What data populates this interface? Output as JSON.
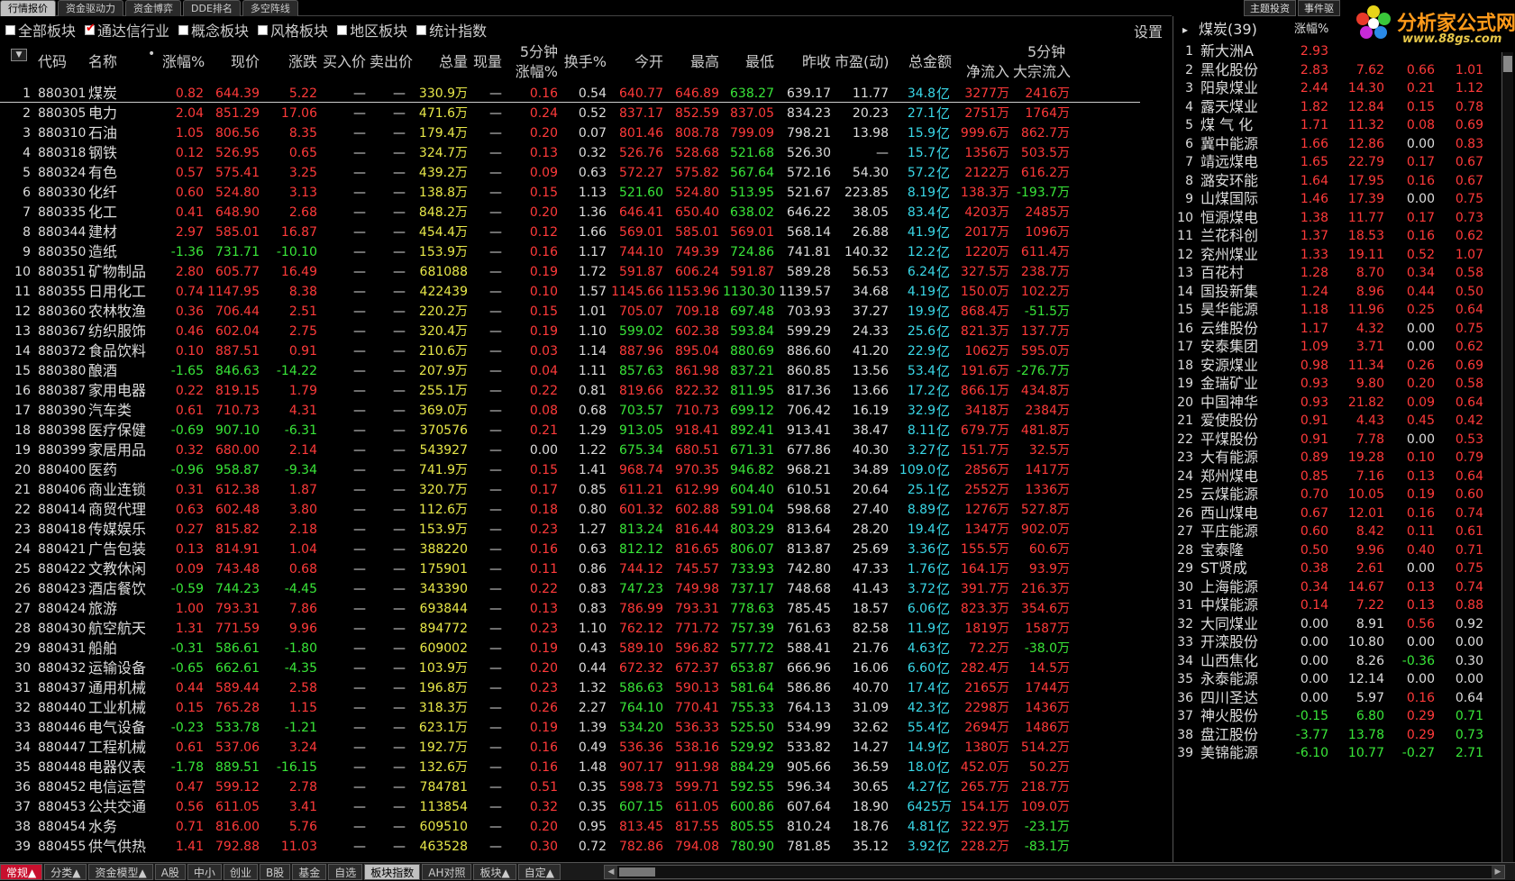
{
  "top_tabs": [
    {
      "label": "行情报价",
      "active": true
    },
    {
      "label": "资金驱动力",
      "active": false
    },
    {
      "label": "资金博弈",
      "active": false
    },
    {
      "label": "DDE排名",
      "active": false
    },
    {
      "label": "多空阵线",
      "active": false
    }
  ],
  "top_right_tabs": [
    "主题投资",
    "事件驱"
  ],
  "logo": {
    "title": "分析家公式网",
    "url": "www.88gs.com"
  },
  "filters": [
    {
      "label": "全部板块",
      "checked": false
    },
    {
      "label": "通达信行业",
      "checked": true
    },
    {
      "label": "概念板块",
      "checked": false
    },
    {
      "label": "风格板块",
      "checked": false
    },
    {
      "label": "地区板块",
      "checked": false
    },
    {
      "label": "统计指数",
      "checked": false
    }
  ],
  "settings_label": "设置",
  "headers": {
    "code": "代码",
    "name": "名称",
    "pct": "涨幅%",
    "price": "现价",
    "chg": "涨跌",
    "bid": "买入价",
    "ask": "卖出价",
    "vol": "总量",
    "cur": "现量",
    "m5_a": "5分钟",
    "m5_b": "涨幅%",
    "turn": "换手%",
    "open": "今开",
    "high": "最高",
    "low": "最低",
    "prev": "昨收",
    "pe": "市盈(动)",
    "amt": "总金额",
    "flow_top": "5分钟",
    "net": "净流入",
    "block": "大宗流入"
  },
  "rows": [
    [
      "1",
      "880301",
      "煤炭",
      "0.82",
      "644.39",
      "5.22",
      "—",
      "—",
      "330.9万",
      "—",
      "0.16",
      "0.54",
      "640.77",
      "646.89",
      "638.27",
      "639.17",
      "11.77",
      "34.8",
      "3277万",
      "2416万"
    ],
    [
      "2",
      "880305",
      "电力",
      "2.04",
      "851.29",
      "17.06",
      "—",
      "—",
      "471.6万",
      "—",
      "0.24",
      "0.52",
      "837.17",
      "852.59",
      "837.05",
      "834.23",
      "20.23",
      "27.1",
      "2751万",
      "1764万"
    ],
    [
      "3",
      "880310",
      "石油",
      "1.05",
      "806.56",
      "8.35",
      "—",
      "—",
      "179.4万",
      "—",
      "0.20",
      "0.07",
      "801.46",
      "808.78",
      "799.09",
      "798.21",
      "13.98",
      "15.9",
      "999.6万",
      "862.7万"
    ],
    [
      "4",
      "880318",
      "钢铁",
      "0.12",
      "526.95",
      "0.65",
      "—",
      "—",
      "324.7万",
      "—",
      "0.13",
      "0.32",
      "526.76",
      "528.68",
      "521.68",
      "526.30",
      "—",
      "15.7",
      "1356万",
      "503.5万"
    ],
    [
      "5",
      "880324",
      "有色",
      "0.57",
      "575.41",
      "3.25",
      "—",
      "—",
      "439.2万",
      "—",
      "0.09",
      "0.63",
      "572.27",
      "575.82",
      "567.64",
      "572.16",
      "54.30",
      "57.2",
      "2122万",
      "616.2万"
    ],
    [
      "6",
      "880330",
      "化纤",
      "0.60",
      "524.80",
      "3.13",
      "—",
      "—",
      "138.8万",
      "—",
      "0.15",
      "1.13",
      "521.60",
      "524.80",
      "513.95",
      "521.67",
      "223.85",
      "8.19",
      "138.3万",
      "-193.7万"
    ],
    [
      "7",
      "880335",
      "化工",
      "0.41",
      "648.90",
      "2.68",
      "—",
      "—",
      "848.2万",
      "—",
      "0.20",
      "1.36",
      "646.41",
      "650.40",
      "638.02",
      "646.22",
      "38.05",
      "83.4",
      "4203万",
      "2485万"
    ],
    [
      "8",
      "880344",
      "建材",
      "2.97",
      "585.01",
      "16.87",
      "—",
      "—",
      "454.4万",
      "—",
      "0.12",
      "1.66",
      "569.01",
      "585.01",
      "569.01",
      "568.14",
      "26.88",
      "41.9",
      "2017万",
      "1096万"
    ],
    [
      "9",
      "880350",
      "造纸",
      "-1.36",
      "731.71",
      "-10.10",
      "—",
      "—",
      "153.9万",
      "—",
      "0.16",
      "1.17",
      "744.10",
      "749.39",
      "724.86",
      "741.81",
      "140.32",
      "12.2",
      "1220万",
      "611.4万"
    ],
    [
      "10",
      "880351",
      "矿物制品",
      "2.80",
      "605.77",
      "16.49",
      "—",
      "—",
      "681088",
      "—",
      "0.19",
      "1.72",
      "591.87",
      "606.24",
      "591.87",
      "589.28",
      "56.53",
      "6.24",
      "327.5万",
      "238.7万"
    ],
    [
      "11",
      "880355",
      "日用化工",
      "0.74",
      "1147.95",
      "8.38",
      "—",
      "—",
      "422439",
      "—",
      "0.10",
      "1.57",
      "1145.66",
      "1153.96",
      "1130.30",
      "1139.57",
      "34.68",
      "4.19",
      "150.0万",
      "102.2万"
    ],
    [
      "12",
      "880360",
      "农林牧渔",
      "0.36",
      "706.44",
      "2.51",
      "—",
      "—",
      "220.2万",
      "—",
      "0.15",
      "1.01",
      "705.07",
      "709.18",
      "697.48",
      "703.93",
      "37.27",
      "19.9",
      "868.4万",
      "-51.5万"
    ],
    [
      "13",
      "880367",
      "纺织服饰",
      "0.46",
      "602.04",
      "2.75",
      "—",
      "—",
      "320.4万",
      "—",
      "0.19",
      "1.10",
      "599.02",
      "602.38",
      "593.84",
      "599.29",
      "24.33",
      "25.6",
      "821.3万",
      "137.7万"
    ],
    [
      "14",
      "880372",
      "食品饮料",
      "0.10",
      "887.51",
      "0.91",
      "—",
      "—",
      "210.6万",
      "—",
      "0.03",
      "1.14",
      "887.96",
      "895.04",
      "880.69",
      "886.60",
      "41.20",
      "22.9",
      "1062万",
      "595.0万"
    ],
    [
      "15",
      "880380",
      "酿酒",
      "-1.65",
      "846.63",
      "-14.22",
      "—",
      "—",
      "207.9万",
      "—",
      "0.04",
      "1.11",
      "857.63",
      "861.98",
      "837.21",
      "860.85",
      "13.56",
      "53.4",
      "191.6万",
      "-276.7万"
    ],
    [
      "16",
      "880387",
      "家用电器",
      "0.22",
      "819.15",
      "1.79",
      "—",
      "—",
      "255.1万",
      "—",
      "0.22",
      "0.81",
      "819.66",
      "822.32",
      "811.95",
      "817.36",
      "13.66",
      "17.2",
      "866.1万",
      "434.8万"
    ],
    [
      "17",
      "880390",
      "汽车类",
      "0.61",
      "710.73",
      "4.31",
      "—",
      "—",
      "369.0万",
      "—",
      "0.08",
      "0.68",
      "703.57",
      "710.73",
      "699.12",
      "706.42",
      "16.19",
      "32.9",
      "3418万",
      "2384万"
    ],
    [
      "18",
      "880398",
      "医疗保健",
      "-0.69",
      "907.10",
      "-6.31",
      "—",
      "—",
      "370576",
      "—",
      "0.21",
      "1.29",
      "913.05",
      "918.41",
      "892.41",
      "913.41",
      "38.47",
      "8.11",
      "679.7万",
      "481.8万"
    ],
    [
      "19",
      "880399",
      "家居用品",
      "0.32",
      "680.00",
      "2.14",
      "—",
      "—",
      "543927",
      "—",
      "0.00",
      "1.22",
      "675.34",
      "680.51",
      "671.31",
      "677.86",
      "40.30",
      "3.27",
      "151.7万",
      "32.5万"
    ],
    [
      "20",
      "880400",
      "医药",
      "-0.96",
      "958.87",
      "-9.34",
      "—",
      "—",
      "741.9万",
      "—",
      "0.15",
      "1.41",
      "968.74",
      "970.35",
      "946.82",
      "968.21",
      "34.89",
      "109.0",
      "2856万",
      "1417万"
    ],
    [
      "21",
      "880406",
      "商业连锁",
      "0.31",
      "612.38",
      "1.87",
      "—",
      "—",
      "320.7万",
      "—",
      "0.17",
      "0.85",
      "611.21",
      "612.99",
      "604.40",
      "610.51",
      "20.64",
      "25.1",
      "2552万",
      "1336万"
    ],
    [
      "22",
      "880414",
      "商贸代理",
      "0.63",
      "602.48",
      "3.80",
      "—",
      "—",
      "112.6万",
      "—",
      "0.18",
      "0.80",
      "601.32",
      "602.88",
      "591.04",
      "598.68",
      "27.40",
      "8.89",
      "1276万",
      "527.8万"
    ],
    [
      "23",
      "880418",
      "传媒娱乐",
      "0.27",
      "815.82",
      "2.18",
      "—",
      "—",
      "153.9万",
      "—",
      "0.23",
      "1.27",
      "813.24",
      "816.44",
      "803.29",
      "813.64",
      "28.20",
      "19.4",
      "1347万",
      "902.0万"
    ],
    [
      "24",
      "880421",
      "广告包装",
      "0.13",
      "814.91",
      "1.04",
      "—",
      "—",
      "388220",
      "—",
      "0.16",
      "0.63",
      "812.12",
      "816.65",
      "806.07",
      "813.87",
      "25.69",
      "3.36",
      "155.5万",
      "60.6万"
    ],
    [
      "25",
      "880422",
      "文教休闲",
      "0.09",
      "743.48",
      "0.68",
      "—",
      "—",
      "175901",
      "—",
      "0.11",
      "0.86",
      "744.12",
      "745.57",
      "733.93",
      "742.80",
      "47.33",
      "1.76",
      "164.1万",
      "93.9万"
    ],
    [
      "26",
      "880423",
      "酒店餐饮",
      "-0.59",
      "744.23",
      "-4.45",
      "—",
      "—",
      "343390",
      "—",
      "0.22",
      "0.83",
      "747.23",
      "749.98",
      "737.17",
      "748.68",
      "41.43",
      "3.72",
      "391.7万",
      "216.3万"
    ],
    [
      "27",
      "880424",
      "旅游",
      "1.00",
      "793.31",
      "7.86",
      "—",
      "—",
      "693844",
      "—",
      "0.13",
      "0.83",
      "786.99",
      "793.31",
      "778.63",
      "785.45",
      "18.57",
      "6.06",
      "823.3万",
      "354.6万"
    ],
    [
      "28",
      "880430",
      "航空航天",
      "1.31",
      "771.59",
      "9.96",
      "—",
      "—",
      "894772",
      "—",
      "0.23",
      "1.10",
      "762.12",
      "771.72",
      "757.39",
      "761.63",
      "82.58",
      "11.9",
      "1819万",
      "1587万"
    ],
    [
      "29",
      "880431",
      "船舶",
      "-0.31",
      "586.61",
      "-1.80",
      "—",
      "—",
      "609002",
      "—",
      "0.19",
      "0.43",
      "589.10",
      "596.82",
      "577.72",
      "588.41",
      "21.76",
      "4.63",
      "72.2万",
      "-38.0万"
    ],
    [
      "30",
      "880432",
      "运输设备",
      "-0.65",
      "662.61",
      "-4.35",
      "—",
      "—",
      "103.9万",
      "—",
      "0.20",
      "0.44",
      "672.32",
      "672.37",
      "653.87",
      "666.96",
      "16.06",
      "6.60",
      "282.4万",
      "14.5万"
    ],
    [
      "31",
      "880437",
      "通用机械",
      "0.44",
      "589.44",
      "2.58",
      "—",
      "—",
      "196.8万",
      "—",
      "0.23",
      "1.32",
      "586.63",
      "590.13",
      "581.64",
      "586.86",
      "40.70",
      "17.4",
      "2165万",
      "1744万"
    ],
    [
      "32",
      "880440",
      "工业机械",
      "0.15",
      "765.28",
      "1.15",
      "—",
      "—",
      "318.3万",
      "—",
      "0.26",
      "2.27",
      "764.10",
      "770.41",
      "755.33",
      "764.13",
      "31.09",
      "42.3",
      "2298万",
      "1436万"
    ],
    [
      "33",
      "880446",
      "电气设备",
      "-0.23",
      "533.78",
      "-1.21",
      "—",
      "—",
      "623.1万",
      "—",
      "0.19",
      "1.39",
      "534.20",
      "536.33",
      "525.50",
      "534.99",
      "32.62",
      "55.4",
      "2694万",
      "1486万"
    ],
    [
      "34",
      "880447",
      "工程机械",
      "0.61",
      "537.06",
      "3.24",
      "—",
      "—",
      "192.7万",
      "—",
      "0.16",
      "0.49",
      "536.36",
      "538.16",
      "529.92",
      "533.82",
      "14.27",
      "14.9",
      "1380万",
      "514.2万"
    ],
    [
      "35",
      "880448",
      "电器仪表",
      "-1.78",
      "889.51",
      "-16.15",
      "—",
      "—",
      "132.6万",
      "—",
      "0.16",
      "1.48",
      "907.17",
      "911.98",
      "884.29",
      "905.66",
      "36.59",
      "18.0",
      "452.0万",
      "50.2万"
    ],
    [
      "36",
      "880452",
      "电信运营",
      "0.47",
      "599.12",
      "2.78",
      "—",
      "—",
      "784781",
      "—",
      "0.51",
      "0.35",
      "598.73",
      "599.71",
      "592.55",
      "596.34",
      "30.65",
      "4.27",
      "265.7万",
      "218.7万"
    ],
    [
      "37",
      "880453",
      "公共交通",
      "0.56",
      "611.05",
      "3.41",
      "—",
      "—",
      "113854",
      "—",
      "0.32",
      "0.35",
      "607.15",
      "611.05",
      "600.86",
      "607.64",
      "18.90",
      "6425万",
      "154.1万",
      "109.0万"
    ],
    [
      "38",
      "880454",
      "水务",
      "0.71",
      "816.00",
      "5.76",
      "—",
      "—",
      "609510",
      "—",
      "0.20",
      "0.95",
      "813.45",
      "817.55",
      "805.55",
      "810.24",
      "18.76",
      "4.81",
      "322.9万",
      "-23.1万"
    ],
    [
      "39",
      "880455",
      "供气供热",
      "1.41",
      "792.88",
      "11.03",
      "—",
      "—",
      "463528",
      "—",
      "0.30",
      "0.72",
      "782.86",
      "794.08",
      "780.90",
      "781.85",
      "35.12",
      "3.92",
      "228.2万",
      "-83.1万"
    ]
  ],
  "yi_unit": "亿",
  "side": {
    "title": "煤炭(39)",
    "header_pct": "涨幅%",
    "rows": [
      [
        "1",
        "新大洲A",
        "2.93",
        "",
        "",
        ""
      ],
      [
        "2",
        "黑化股份",
        "2.83",
        "7.62",
        "0.66",
        "1.01"
      ],
      [
        "3",
        "阳泉煤业",
        "2.44",
        "14.30",
        "0.21",
        "1.12"
      ],
      [
        "4",
        "露天煤业",
        "1.82",
        "12.84",
        "0.15",
        "0.78"
      ],
      [
        "5",
        "煤 气 化",
        "1.71",
        "11.32",
        "0.08",
        "0.69"
      ],
      [
        "6",
        "冀中能源",
        "1.66",
        "12.86",
        "0.00",
        "0.83"
      ],
      [
        "7",
        "靖远煤电",
        "1.65",
        "22.79",
        "0.17",
        "0.67"
      ],
      [
        "8",
        "潞安环能",
        "1.64",
        "17.95",
        "0.16",
        "0.67"
      ],
      [
        "9",
        "山煤国际",
        "1.46",
        "17.39",
        "0.00",
        "0.75"
      ],
      [
        "10",
        "恒源煤电",
        "1.38",
        "11.77",
        "0.17",
        "0.73"
      ],
      [
        "11",
        "兰花科创",
        "1.37",
        "18.53",
        "0.16",
        "0.62"
      ],
      [
        "12",
        "兖州煤业",
        "1.33",
        "19.11",
        "0.52",
        "1.07"
      ],
      [
        "13",
        "百花村",
        "1.28",
        "8.70",
        "0.34",
        "0.58"
      ],
      [
        "14",
        "国投新集",
        "1.24",
        "8.96",
        "0.44",
        "0.50"
      ],
      [
        "15",
        "昊华能源",
        "1.18",
        "11.96",
        "0.25",
        "0.64"
      ],
      [
        "16",
        "云维股份",
        "1.17",
        "4.32",
        "0.00",
        "0.75"
      ],
      [
        "17",
        "安泰集团",
        "1.09",
        "3.71",
        "0.00",
        "0.62"
      ],
      [
        "18",
        "安源煤业",
        "0.98",
        "11.34",
        "0.26",
        "0.69"
      ],
      [
        "19",
        "金瑞矿业",
        "0.93",
        "9.80",
        "0.20",
        "0.58"
      ],
      [
        "20",
        "中国神华",
        "0.93",
        "21.82",
        "0.09",
        "0.64"
      ],
      [
        "21",
        "爱使股份",
        "0.91",
        "4.43",
        "0.45",
        "0.42"
      ],
      [
        "22",
        "平煤股份",
        "0.91",
        "7.78",
        "0.00",
        "0.53"
      ],
      [
        "23",
        "大有能源",
        "0.89",
        "19.28",
        "0.10",
        "0.79"
      ],
      [
        "24",
        "郑州煤电",
        "0.85",
        "7.16",
        "0.13",
        "0.64"
      ],
      [
        "25",
        "云煤能源",
        "0.70",
        "10.05",
        "0.19",
        "0.60"
      ],
      [
        "26",
        "西山煤电",
        "0.67",
        "12.01",
        "0.16",
        "0.74"
      ],
      [
        "27",
        "平庄能源",
        "0.60",
        "8.42",
        "0.11",
        "0.61"
      ],
      [
        "28",
        "宝泰隆",
        "0.50",
        "9.96",
        "0.40",
        "0.71"
      ],
      [
        "29",
        "ST贤成",
        "0.38",
        "2.61",
        "0.00",
        "0.75"
      ],
      [
        "30",
        "上海能源",
        "0.34",
        "14.67",
        "0.13",
        "0.74"
      ],
      [
        "31",
        "中煤能源",
        "0.14",
        "7.22",
        "0.13",
        "0.88"
      ],
      [
        "32",
        "大同煤业",
        "0.00",
        "8.91",
        "0.56",
        "0.92"
      ],
      [
        "33",
        "开滦股份",
        "0.00",
        "10.80",
        "0.00",
        "0.00"
      ],
      [
        "34",
        "山西焦化",
        "0.00",
        "8.26",
        "-0.36",
        "0.30"
      ],
      [
        "35",
        "永泰能源",
        "0.00",
        "12.14",
        "0.00",
        "0.00"
      ],
      [
        "36",
        "四川圣达",
        "0.00",
        "5.97",
        "0.16",
        "0.64"
      ],
      [
        "37",
        "神火股份",
        "-0.15",
        "6.80",
        "0.29",
        "0.71"
      ],
      [
        "38",
        "盘江股份",
        "-3.77",
        "13.78",
        "0.29",
        "0.73"
      ],
      [
        "39",
        "美锦能源",
        "-6.10",
        "10.77",
        "-0.27",
        "2.71"
      ]
    ]
  },
  "bottom_tabs": [
    {
      "label": "常规▲",
      "style": "red"
    },
    {
      "label": "分类▲",
      "style": ""
    },
    {
      "label": "资金模型▲",
      "style": ""
    },
    {
      "label": "A股",
      "style": ""
    },
    {
      "label": "中小",
      "style": ""
    },
    {
      "label": "创业",
      "style": ""
    },
    {
      "label": "B股",
      "style": ""
    },
    {
      "label": "基金",
      "style": ""
    },
    {
      "label": "自选",
      "style": ""
    },
    {
      "label": "板块指数",
      "style": "active"
    },
    {
      "label": "AH对照",
      "style": ""
    },
    {
      "label": "板块▲",
      "style": ""
    },
    {
      "label": "自定▲",
      "style": ""
    }
  ],
  "colors": {
    "up": "#ff3a3a",
    "down": "#39e639",
    "volume": "#e8e84a",
    "amount": "#3ad8e8"
  }
}
